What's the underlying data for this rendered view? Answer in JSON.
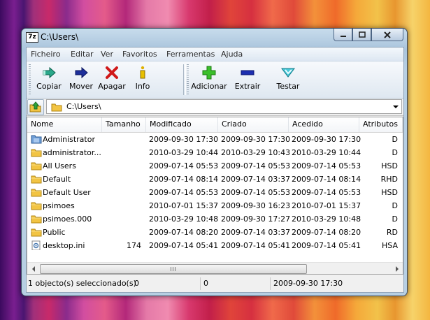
{
  "window": {
    "title": "C:\\Users\\",
    "app_icon": "7z"
  },
  "menu": [
    "Ficheiro",
    "Editar",
    "Ver",
    "Favoritos",
    "Ferramentas",
    "Ajuda"
  ],
  "toolbar": {
    "copy_label": "Copiar",
    "move_label": "Mover",
    "delete_label": "Apagar",
    "info_label": "Info",
    "add_label": "Adicionar",
    "extract_label": "Extrair",
    "test_label": "Testar"
  },
  "address": {
    "path": "C:\\Users\\"
  },
  "columns": [
    "Nome",
    "Tamanho",
    "Modificado",
    "Criado",
    "Acedido",
    "Atributos"
  ],
  "rows": [
    {
      "name": "Administrator",
      "size": "",
      "modified": "2009-09-30 17:30",
      "created": "2009-09-30 17:30",
      "accessed": "2009-09-30 17:30",
      "attr": "D",
      "icon": "special-folder-icon"
    },
    {
      "name": "administrator...",
      "size": "",
      "modified": "2010-03-29 10:44",
      "created": "2010-03-29 10:43",
      "accessed": "2010-03-29 10:44",
      "attr": "D",
      "icon": "folder-icon"
    },
    {
      "name": "All Users",
      "size": "",
      "modified": "2009-07-14 05:53",
      "created": "2009-07-14 05:53",
      "accessed": "2009-07-14 05:53",
      "attr": "HSD",
      "icon": "folder-icon"
    },
    {
      "name": "Default",
      "size": "",
      "modified": "2009-07-14 08:14",
      "created": "2009-07-14 03:37",
      "accessed": "2009-07-14 08:14",
      "attr": "RHD",
      "icon": "folder-icon"
    },
    {
      "name": "Default User",
      "size": "",
      "modified": "2009-07-14 05:53",
      "created": "2009-07-14 05:53",
      "accessed": "2009-07-14 05:53",
      "attr": "HSD",
      "icon": "folder-icon"
    },
    {
      "name": "psimoes",
      "size": "",
      "modified": "2010-07-01 15:37",
      "created": "2009-09-30 16:23",
      "accessed": "2010-07-01 15:37",
      "attr": "D",
      "icon": "folder-icon"
    },
    {
      "name": "psimoes.000",
      "size": "",
      "modified": "2010-03-29 10:48",
      "created": "2009-09-30 17:27",
      "accessed": "2010-03-29 10:48",
      "attr": "D",
      "icon": "folder-icon"
    },
    {
      "name": "Public",
      "size": "",
      "modified": "2009-07-14 08:20",
      "created": "2009-07-14 03:37",
      "accessed": "2009-07-14 08:20",
      "attr": "RD",
      "icon": "folder-icon"
    },
    {
      "name": "desktop.ini",
      "size": "174",
      "modified": "2009-07-14 05:41",
      "created": "2009-07-14 05:41",
      "accessed": "2009-07-14 05:41",
      "attr": "HSA",
      "icon": "settings-file-icon"
    }
  ],
  "status": {
    "selection": "1 objecto(s) seleccionado(s)",
    "size": "0",
    "packed": "0",
    "date": "2009-09-30 17:30"
  }
}
